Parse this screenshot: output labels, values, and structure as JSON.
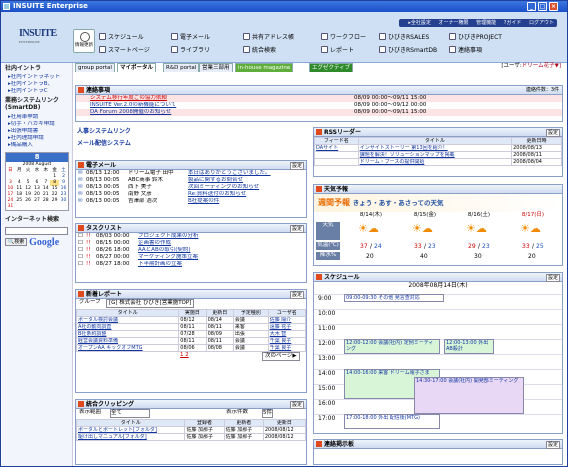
{
  "window": {
    "title": "INSUITE Enterprise"
  },
  "header": {
    "links": [
      "▸全社設定",
      "オーナー権限",
      "管理機能",
      "?ガイド",
      "ログアウト"
    ],
    "logo": "INSUITE",
    "logo_sub": "ENTERPRISE",
    "update_label": "情報更新",
    "nav": [
      "スケジュール",
      "電子メール",
      "共有アドレス帳",
      "ワークフロー",
      "ひびきRSALES",
      "ひびきPROJECT",
      "スマートページ",
      "ライブラリ",
      "統合検索",
      "レポート",
      "ひびきRSmartDB",
      "連絡事項"
    ]
  },
  "tabs": [
    "group portal",
    "マイポータル",
    "R&D portal",
    "営業三部用",
    "in-house magazine",
    "エグゼクティブ"
  ],
  "user": {
    "label": "[ユーザ:",
    "name": "ドリーム花子▼]"
  },
  "sidebar": {
    "h1": "社内イントラ",
    "l1": [
      "▸社内イントラネット",
      "▸社内イントラB、",
      "▸社内イントラC"
    ],
    "h2": "業務システムリンク (SmartDB)",
    "l2": [
      "▸社用車申請",
      "▸切手・ハガキ申請",
      "▸出張申請書",
      "▸社内理請申請",
      "▸備品購入"
    ],
    "cal_day": "8",
    "cal_month": "2008 August",
    "cal_head": [
      "日",
      "月",
      "火",
      "水",
      "木",
      "金",
      "土"
    ],
    "cal_rows": [
      [
        "",
        "",
        "",
        "",
        "",
        "1",
        "2"
      ],
      [
        "3",
        "4",
        "5",
        "6",
        "7",
        "8",
        "9"
      ],
      [
        "10",
        "11",
        "12",
        "13",
        "14",
        "15",
        "16"
      ],
      [
        "17",
        "18",
        "19",
        "20",
        "21",
        "22",
        "23"
      ],
      [
        "24",
        "25",
        "26",
        "27",
        "28",
        "29",
        "30"
      ],
      [
        "31",
        "",
        "",
        "",
        "",
        "",
        ""
      ]
    ],
    "search_h": "インターネット検索",
    "search_btn": "🔍検索",
    "google": "Google"
  },
  "notice": {
    "title": "連絡事項",
    "count": "連絡件数：3件",
    "items": [
      [
        "システム移行年度ごの協力依頼",
        "08/09 00:00～09/11 15:00"
      ],
      [
        "INSUITE Ver.2.0の新機能について",
        "08/09 00:00～09/12 00:00"
      ],
      [
        "DA Forum 2008開催のお知らせ",
        "08/09 00:00～09/11 15:00"
      ]
    ]
  },
  "links": [
    "人事システムリンク",
    "メール配信システム"
  ],
  "mail": {
    "title": "電子メール",
    "rows": [
      [
        "08/13 12:00",
        "ドリーム電子 田中",
        "本日はありがとうございました。"
      ],
      [
        "08/13 00:05",
        "ABC商事 鈴木",
        "製品に関するお問合せ"
      ],
      [
        "08/13 00:05",
        "西下 美子",
        "次回ミーティングのお知らせ"
      ],
      [
        "08/13 00:05",
        "南野 文彦",
        "Re:資料送付のお知らせ"
      ],
      [
        "08/13 00:05",
        "吉澤部 浩次",
        "B社提案の件"
      ]
    ]
  },
  "task": {
    "title": "タスクリスト",
    "rows": [
      [
        "08/03 00:00",
        "プロジェクト成果の分析"
      ],
      [
        "08/15 00:00",
        "企画書の作成"
      ],
      [
        "08/26 18:00",
        "AAとABの取引(契約)"
      ],
      [
        "08/27 00:00",
        "マーケティング施策立案"
      ],
      [
        "08/27 18:00",
        "下半期計画の立案"
      ]
    ]
  },
  "report": {
    "title": "新着レポート",
    "group_label": "グループ",
    "group": "[G] 株式会社 ひびき[営業施TOP]",
    "cols": [
      "タイトル",
      "実施日",
      "更新日",
      "予定種別",
      "ユーザ名"
    ],
    "rows": [
      [
        "ポータル検討会議",
        "08/12",
        "08/14",
        "会議",
        "佐藤 陽介"
      ],
      [
        "A社の動向調査",
        "08/11",
        "08/11",
        "来客",
        "遠藤 花子"
      ],
      [
        "B社条約調整",
        "07/28",
        "08/09",
        "出張",
        "大木 智"
      ],
      [
        "経営会議資料準備",
        "08/11",
        "08/11",
        "会議",
        "千葉 良子"
      ],
      [
        "オープンAA キックオフMTG",
        "08/06",
        "08/08",
        "会議",
        "千葉 良子"
      ]
    ],
    "pages": "1 2",
    "next": "次のページ▶"
  },
  "clip": {
    "title": "統合クリッピング",
    "disp": "表示範囲",
    "disp_val": "全て",
    "cnt": "表示件数",
    "cnt_val": "5件",
    "cols": [
      "タイトル",
      "登録者",
      "更新者",
      "更新日"
    ],
    "rows": [
      [
        "ポータルとポートレット[フォルダ]",
        "佐藤 加那子",
        "佐藤 加那子",
        "2008/08/12"
      ],
      [
        "駆け出しマニュアル[フォルダ]",
        "佐藤 加那子",
        "佐藤 加那子",
        "2008/08/12"
      ]
    ]
  },
  "rss": {
    "title": "RSSリーダー",
    "cols": [
      "フィード名",
      "タイトル",
      "更新日時"
    ],
    "feed": "DAサイト",
    "rows": [
      [
        "インサイトストーリー 第13回を紹介！",
        "2008/08/13"
      ],
      [
        "課題を解決！ソリューションマップを掲載",
        "2008/08/11"
      ],
      [
        "ドリーム・ブースの提供開始",
        "2008/08/04"
      ]
    ]
  },
  "weather": {
    "title": "天気予報",
    "banner": "週間予報",
    "banner2": "きょう・あす・あさっての天気",
    "rowlabels": [
      "天気",
      "気温(℃)",
      "降水%"
    ],
    "days": [
      [
        "8/14(木)",
        "37",
        "24",
        "20"
      ],
      [
        "8/15(金)",
        "33",
        "23",
        "40"
      ],
      [
        "8/16(土)",
        "29",
        "23",
        "30"
      ],
      [
        "8/17(日)",
        "33",
        "25",
        "20"
      ]
    ]
  },
  "schedule": {
    "title": "スケジュール",
    "date": "2008年08月14日(木)",
    "hours": [
      "9:00",
      "10:00",
      "11:00",
      "12:00",
      "13:00",
      "14:00",
      "15:00",
      "16:00",
      "17:00"
    ],
    "events": [
      "09:00-09:30 その他 発言查対応",
      "12:00-12:00 会議(社内) 定例ミーティング",
      "12:00-13:00 外出 AB殺計",
      "14:00-16:00 来客 ドリーム電子さま",
      "14:30-17:00 会議(社内) 開発部ミーティング",
      "17:00-18:00 外出 配信後(MTG)"
    ]
  },
  "bbs": {
    "title": "連絡掲示板"
  }
}
